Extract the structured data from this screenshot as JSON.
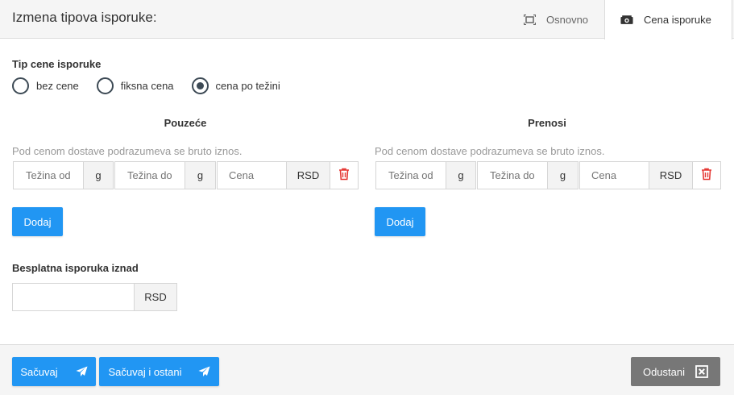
{
  "header": {
    "title": "Izmena tipova isporuke:",
    "tabs": [
      {
        "label": "Osnovno",
        "icon": "expand-icon"
      },
      {
        "label": "Cena isporuke",
        "icon": "money-icon"
      }
    ]
  },
  "price_type": {
    "label": "Tip cene isporuke",
    "options": [
      {
        "label": "bez cene",
        "checked": false
      },
      {
        "label": "fiksna cena",
        "checked": false
      },
      {
        "label": "cena po težini",
        "checked": true
      }
    ]
  },
  "columns": [
    {
      "title": "Pouzeće",
      "hint": "Pod cenom dostave podrazumeva se bruto iznos.",
      "weight_from_placeholder": "Težina od",
      "weight_to_placeholder": "Težina do",
      "price_placeholder": "Cena",
      "weight_unit": "g",
      "currency": "RSD",
      "add_label": "Dodaj"
    },
    {
      "title": "Prenosi",
      "hint": "Pod cenom dostave podrazumeva se bruto iznos.",
      "weight_from_placeholder": "Težina od",
      "weight_to_placeholder": "Težina do",
      "price_placeholder": "Cena",
      "weight_unit": "g",
      "currency": "RSD",
      "add_label": "Dodaj"
    }
  ],
  "free_shipping": {
    "label": "Besplatna isporuka iznad",
    "value": "",
    "currency": "RSD"
  },
  "footer": {
    "save_label": "Sačuvaj",
    "save_stay_label": "Sačuvaj i ostani",
    "cancel_label": "Odustani"
  },
  "colors": {
    "primary": "#2196f3",
    "danger": "#e53935",
    "cancel": "#777777"
  }
}
